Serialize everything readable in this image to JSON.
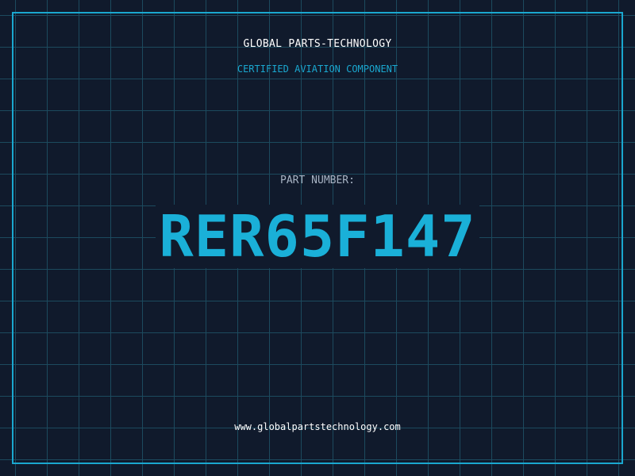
{
  "header": {
    "company": "GLOBAL PARTS-TECHNOLOGY",
    "subtitle": "CERTIFIED AVIATION COMPONENT"
  },
  "part": {
    "label": "PART NUMBER:",
    "number": "RER65F147"
  },
  "footer": {
    "website": "www.globalpartstechnology.com"
  },
  "colors": {
    "background": "#101a2c",
    "grid": "#1c4a5e",
    "accent": "#1aa7cf",
    "text": "#ffffff",
    "muted": "#a8b4c4"
  }
}
